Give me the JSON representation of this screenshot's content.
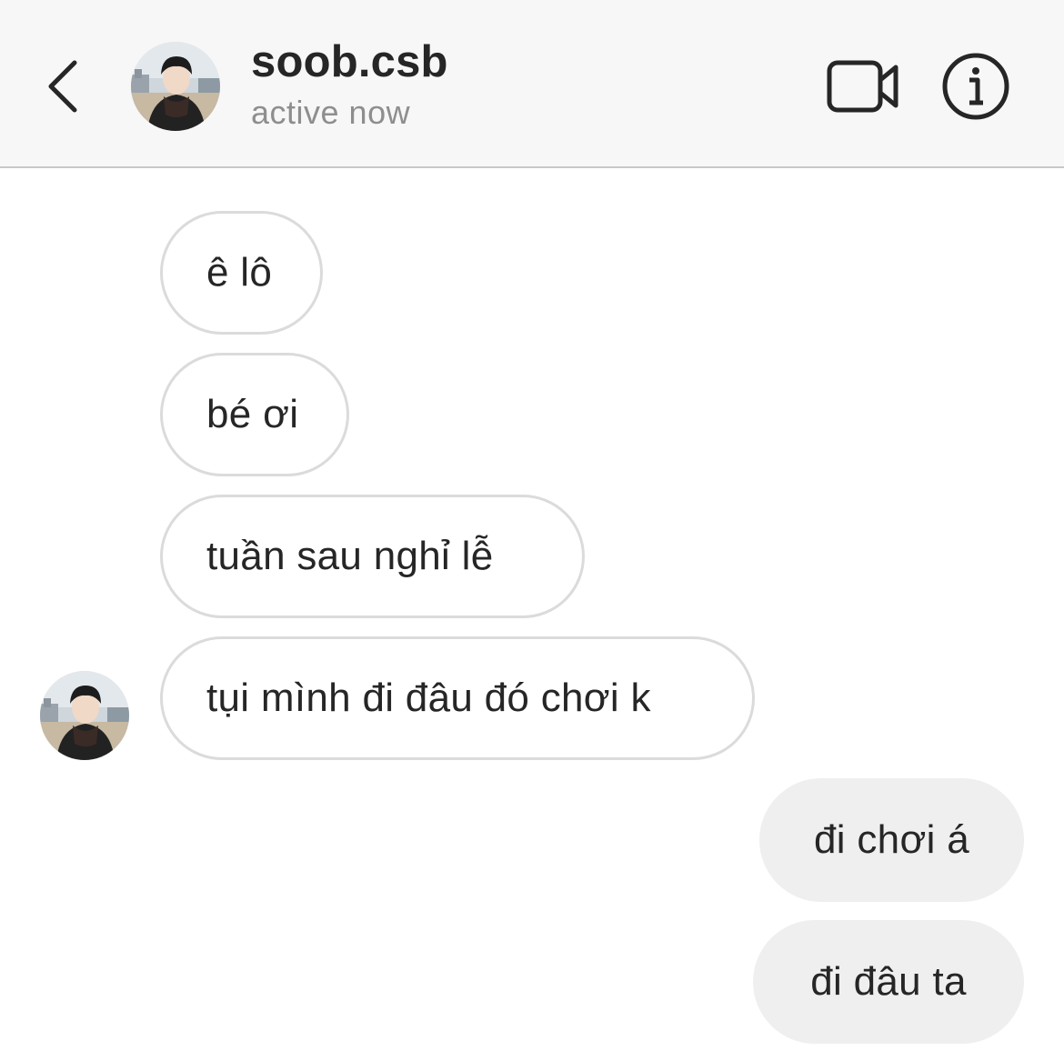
{
  "header": {
    "back_icon": "chevron-left-icon",
    "username": "soob.csb",
    "status": "active now",
    "video_icon": "video-camera-icon",
    "info_icon": "info-icon"
  },
  "messages": [
    {
      "text": "ê lô",
      "direction": "incoming"
    },
    {
      "text": "bé ơi",
      "direction": "incoming"
    },
    {
      "text": "tuần sau nghỉ lễ",
      "direction": "incoming"
    },
    {
      "text": "tụi mình đi đâu đó chơi k",
      "direction": "incoming"
    },
    {
      "text": "đi chơi á",
      "direction": "outgoing"
    },
    {
      "text": "đi đâu ta",
      "direction": "outgoing"
    }
  ],
  "colors": {
    "header_bg": "#f7f7f7",
    "text_primary": "#262626",
    "text_secondary": "#8e8e8e",
    "incoming_border": "#dbdbdb",
    "outgoing_bg": "#efefef"
  }
}
